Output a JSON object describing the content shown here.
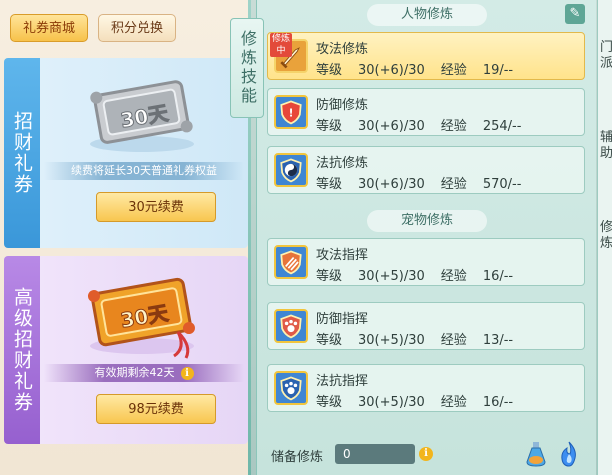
{
  "shop": {
    "tabs": [
      {
        "label": "礼券商城",
        "active": true
      },
      {
        "label": "积分兑换",
        "active": false
      }
    ],
    "cards": [
      {
        "side_label": "招财礼券",
        "ticket_text": "30天",
        "note": "续费将延长30天普通礼券权益",
        "button": "30元续费"
      },
      {
        "side_label": "高级招财礼券",
        "ticket_text": "30天",
        "note": "有效期剩余42天",
        "button": "98元续费"
      }
    ]
  },
  "cultivation": {
    "side_tab": "修炼技能",
    "person_title": "人物修炼",
    "pet_title": "宠物修炼",
    "current_badge": "修炼中",
    "level_label": "等级",
    "exp_label": "经验",
    "person_skills": [
      {
        "name": "攻法修炼",
        "level": "30(+6)/30",
        "exp": "19/--",
        "current": true,
        "icon": "sword-icon"
      },
      {
        "name": "防御修炼",
        "level": "30(+6)/30",
        "exp": "254/--",
        "current": false,
        "icon": "shield-icon"
      },
      {
        "name": "法抗修炼",
        "level": "30(+6)/30",
        "exp": "570/--",
        "current": false,
        "icon": "taiji-shield-icon"
      }
    ],
    "pet_skills": [
      {
        "name": "攻法指挥",
        "level": "30(+5)/30",
        "exp": "16/--",
        "icon": "claw-icon"
      },
      {
        "name": "防御指挥",
        "level": "30(+5)/30",
        "exp": "13/--",
        "icon": "paw-shield-icon"
      },
      {
        "name": "法抗指挥",
        "level": "30(+5)/30",
        "exp": "16/--",
        "icon": "paw-magic-icon"
      }
    ],
    "reserve_label": "储备修炼",
    "reserve_value": "0"
  },
  "edge": {
    "texts": [
      "门派",
      "辅助",
      "修炼"
    ]
  },
  "colors": {
    "accent_gold": "#f8c64f",
    "card1_side": "#3a97d9",
    "card2_side": "#9660cf",
    "panel_teal": "#c6e3dc"
  }
}
